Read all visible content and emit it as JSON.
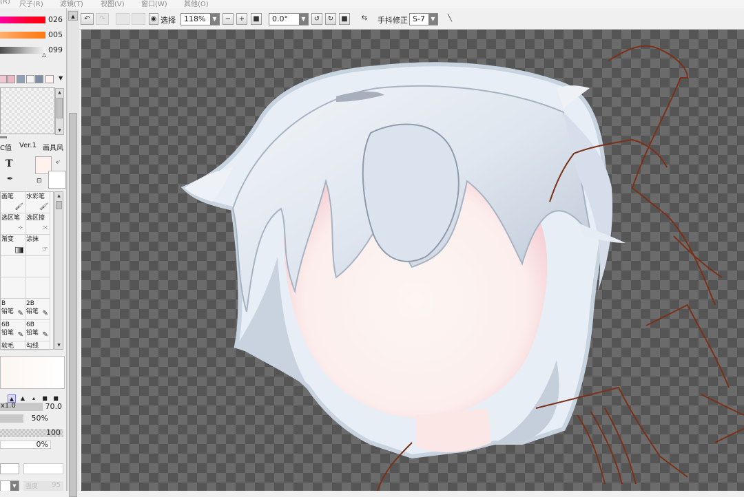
{
  "menubar": {
    "items": [
      "(R)",
      "尺子(R)",
      "滤镜(T)",
      "视图(V)",
      "窗口(W)",
      "其他(O)"
    ]
  },
  "toolbar": {
    "select_label": "选择",
    "zoom_value": "118%",
    "zoom_minus": "−",
    "zoom_plus": "+",
    "rotation_value": "0.0°",
    "stabilizer_label": "手抖修正",
    "stabilizer_value": "S-7"
  },
  "color_sliders": [
    {
      "value": "026"
    },
    {
      "value": "005"
    },
    {
      "value": "099"
    }
  ],
  "swatch_colors": [
    "#f0c8d0",
    "#e8b8c4",
    "#8fa0b4",
    "#f4f4f4",
    "#7e8ea2",
    "#fdf2ee"
  ],
  "panel_tabs": [
    "C值",
    "Ver.1",
    "画具风"
  ],
  "tool_icons": {
    "text_tool": "T",
    "eyedropper": "eyedropper-icon"
  },
  "brushes": [
    {
      "l1": "画笔",
      "l2": "",
      "icon": "brush-icon"
    },
    {
      "l1": "水彩笔",
      "l2": "",
      "icon": "brush-icon"
    },
    {
      "l1": "选区笔",
      "l2": "",
      "icon": "select-pen-icon"
    },
    {
      "l1": "选区擦",
      "l2": "",
      "icon": "select-eraser-icon"
    },
    {
      "l1": "渐变",
      "l2": "",
      "icon": "gradient-icon"
    },
    {
      "l1": "涂抹",
      "l2": "",
      "icon": "smudge-icon"
    },
    {
      "l1": "",
      "l2": "",
      "icon": ""
    },
    {
      "l1": "",
      "l2": "",
      "icon": ""
    },
    {
      "l1": "B",
      "l2": "铅笔",
      "icon": "pencil-icon"
    },
    {
      "l1": "2B",
      "l2": "铅笔",
      "icon": "pencil-icon"
    },
    {
      "l1": "6B",
      "l2": "铅笔",
      "icon": "pencil-icon"
    },
    {
      "l1": "6B",
      "l2": "铅笔",
      "icon": "pencil-icon"
    },
    {
      "l1": "软毛",
      "l2": "",
      "icon": ""
    },
    {
      "l1": "勾线",
      "l2": "",
      "icon": ""
    }
  ],
  "properties": {
    "size_multiplier": "x1.0",
    "size_value": "70.0",
    "min_size_value": "50%",
    "density_value": "100",
    "blend_value": "0%",
    "disabled_label": "强度",
    "disabled_value": "95"
  },
  "colors": {
    "line_art": "#7a3118",
    "hair_light": "#e4ebf3",
    "hair_shadow": "#a4b0c0",
    "skin": "#fcefea",
    "skin_blush": "#f4c6ce"
  }
}
